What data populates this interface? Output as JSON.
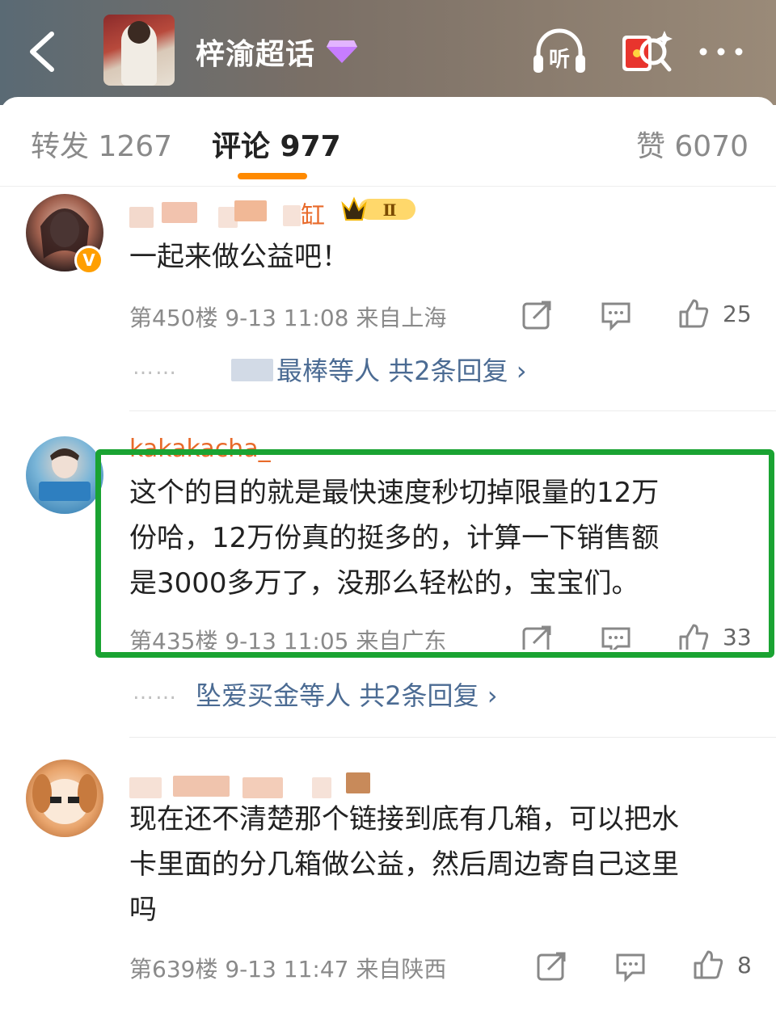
{
  "header": {
    "title": "梓渝超话",
    "listen_label": "听"
  },
  "tabs": [
    {
      "label": "转发 1267"
    },
    {
      "label": "评论 977"
    },
    {
      "label": "赞 6070"
    }
  ],
  "comments": [
    {
      "name_tail": "缸",
      "text": "一起来做公益吧！",
      "floor": "第450楼",
      "time": "9-13 11:08",
      "location": "来自上海",
      "likes": "25",
      "replies_who": "最棒等人",
      "replies_total": "共2条回复",
      "dots": "……",
      "badge_level": "Ⅱ",
      "verified": "V"
    },
    {
      "name": "kakakacha_",
      "text_lines": [
        "这个的目的就是最快速度秒切掉限量的12万",
        "份哈，12万份真的挺多的，计算一下销售额",
        "是3000多万了，没那么轻松的，宝宝们。"
      ],
      "floor": "第435楼",
      "time": "9-13 11:05",
      "location": "来自广东",
      "likes": "33",
      "replies_who": "坠爱买金等人",
      "replies_total": "共2条回复",
      "dots": "……"
    },
    {
      "text_lines": [
        "现在还不清楚那个链接到底有几箱，可以把水",
        "卡里面的分几箱做公益，然后周边寄自己这里",
        "吗"
      ],
      "floor": "第639楼",
      "time": "9-13 11:47",
      "location": "来自陕西",
      "likes": "8"
    }
  ],
  "colors": {
    "accent": "#ff8a00",
    "highlight_box": "#1aa332",
    "link": "#4b6b93"
  }
}
